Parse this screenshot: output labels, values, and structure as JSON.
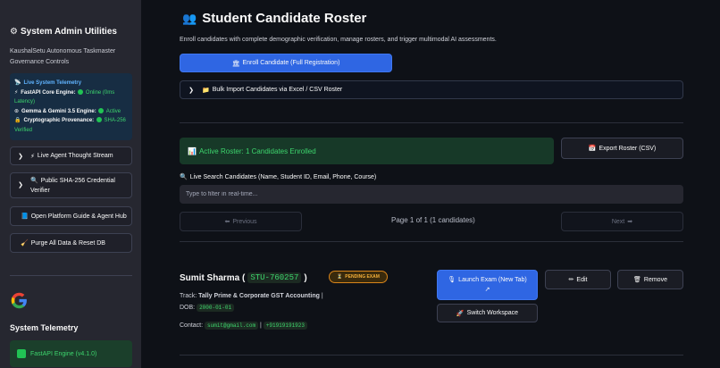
{
  "sidebar": {
    "title": "System Admin Utilities",
    "subtitle": "KaushalSetu Autonomous Taskmaster Governance Controls",
    "telemetry": {
      "heading": "Live System Telemetry",
      "core_label": "FastAPI Core Engine:",
      "core_status": "Online (0ms Latency)",
      "gemini_label": "Gemma & Gemini 3.5 Engine:",
      "gemini_status": "Active",
      "crypto_label": "Cryptographic Provenance:",
      "crypto_status": "SHA-256 Verified"
    },
    "thought_stream_label": "Live Agent Thought Stream",
    "verifier_label": "Public SHA-256 Credential Verifier",
    "guide_button": "Open Platform Guide & Agent Hub",
    "purge_button": "Purge All Data & Reset DB",
    "section_title": "System Telemetry",
    "fastapi_status": "FastAPI Engine (v4.1.0)"
  },
  "main": {
    "title": "Student Candidate Roster",
    "description": "Enroll candidates with complete demographic verification, manage rosters, and trigger multimodal AI assessments.",
    "enroll_button": "Enroll Candidate (Full Registration)",
    "bulk_import_label": "Bulk Import Candidates via Excel / CSV Roster",
    "roster_status": "Active Roster: 1 Candidates Enrolled",
    "export_button": "Export Roster (CSV)",
    "search": {
      "label": "Live Search Candidates (Name, Student ID, Email, Phone, Course)",
      "placeholder": "Type to filter in real-time..."
    },
    "pagination": {
      "previous": "Previous",
      "info": "Page 1 of 1 (1 candidates)",
      "next": "Next"
    },
    "candidate": {
      "name": "Sumit Sharma",
      "id": "STU-760257",
      "status": "PENDING EXAM",
      "track_label": "Track:",
      "track": "Tally Prime & Corporate GST Accounting",
      "dob_label": "DOB:",
      "dob": "2000-01-01",
      "contact_label": "Contact:",
      "email": "sumit@gmail.com",
      "phone": "+91919191923",
      "launch_button": "Launch Exam (New Tab)",
      "edit_button": "Edit",
      "remove_button": "Remove",
      "switch_button": "Switch Workspace"
    }
  },
  "colors": {
    "accent": "#2f66e3",
    "success": "#3dd56d",
    "warning": "#f4b03a",
    "background": "#0e1117",
    "sidebar": "#262730"
  },
  "icons": {
    "sidebar_title": "gear-icon",
    "telemetry": "satellite-icon",
    "core": "lightning-icon",
    "gemini": "brain-icon",
    "crypto": "lock-icon",
    "thought_stream": "lightning-icon",
    "verifier": "magnifier-icon",
    "guide": "book-icon",
    "purge": "broom-icon",
    "title": "people-icon",
    "enroll": "bank-icon",
    "bulk": "folder-icon",
    "roster": "bar-chart-icon",
    "export": "calendar-icon",
    "search": "magnifier-icon",
    "launch": "microphone-icon",
    "edit": "pencil-icon",
    "remove": "trash-icon",
    "switch": "rocket-icon"
  }
}
